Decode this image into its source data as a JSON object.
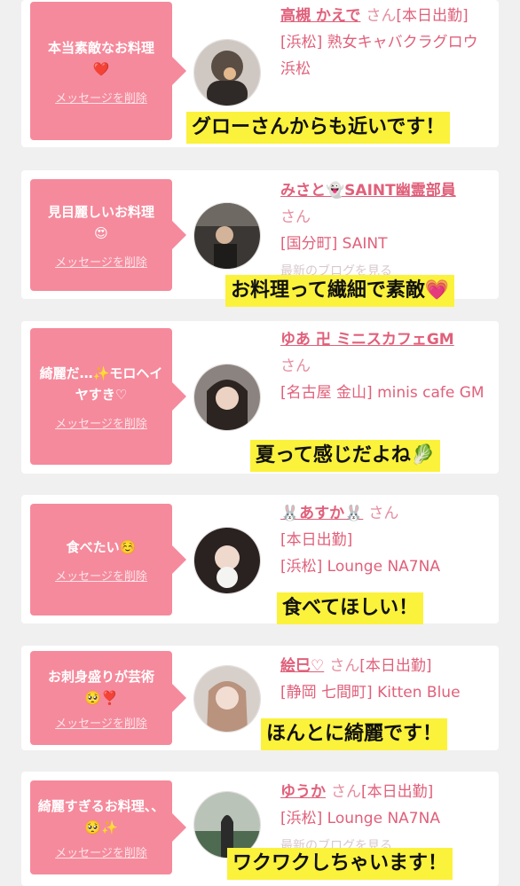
{
  "delete_label": "メッセージを削除",
  "colors": {
    "bubble": "#f58a9c",
    "link": "#e0607a",
    "highlight": "#fbf23c"
  },
  "posts": [
    {
      "message": "本当素敵なお料理\n❤️",
      "name": "高槻 かえで",
      "san": "さん",
      "status": "[本日出勤]",
      "shop": "[浜松] 熟女キャバクラグロウ 浜松",
      "caption": "グローさんからも近いです！"
    },
    {
      "message": "見目麗しいお料理\n😍",
      "name": "みさと👻SAINT幽霊部員",
      "san": "さん",
      "status": "",
      "shop": "[国分町] SAINT",
      "extra": "最新のブログを見る",
      "caption": "お料理って繊細で素敵💗"
    },
    {
      "message": "綺麗だ…✨モロヘイヤすき♡",
      "name": "ゆあ 卍 ミニスカフェGM",
      "san": "さん",
      "status": "",
      "shop": "[名古屋 金山] minis cafe GM",
      "caption": "夏って感じだよね🥬"
    },
    {
      "message": "食べたい☺️",
      "name": "🐰あすか🐰",
      "san": "さん",
      "status": "[本日出勤]",
      "shop": "[浜松] Lounge NA7NA",
      "caption": "食べてほしい！"
    },
    {
      "message": "お刺身盛りが芸術\n🥺❣️",
      "name": "絵巳♡",
      "san": "さん",
      "status": "[本日出勤]",
      "shop": "[静岡 七間町] Kitten Blue",
      "caption": "ほんとに綺麗です！"
    },
    {
      "message": "綺麗すぎるお料理、、🥺✨",
      "name": "ゆうか",
      "san": "さん",
      "status": "[本日出勤]",
      "shop": "[浜松] Lounge NA7NA",
      "extra": "最新のブログを見る",
      "caption": "ワクワクしちゃいます！"
    }
  ]
}
